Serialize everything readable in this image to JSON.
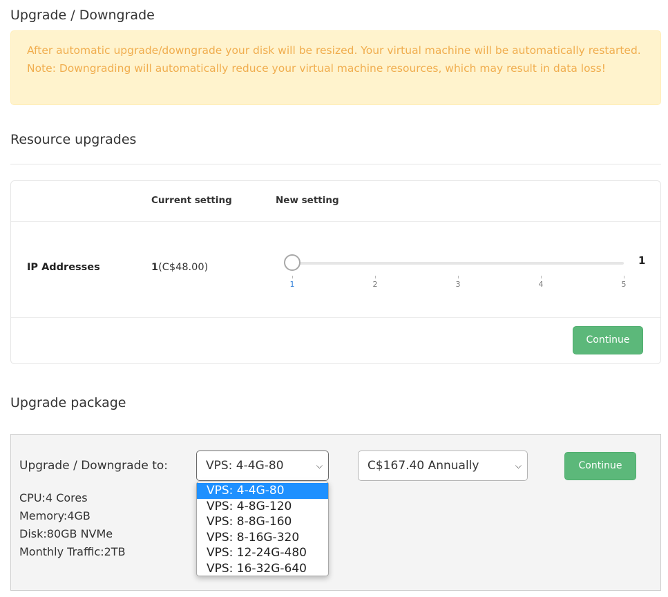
{
  "titles": {
    "upgrade_downgrade": "Upgrade / Downgrade",
    "resource_upgrades": "Resource upgrades",
    "upgrade_package": "Upgrade package"
  },
  "alert": {
    "text": "After automatic upgrade/downgrade your disk will be resized. Your virtual machine will be automatically restarted. Note: Downgrading will automatically reduce your virtual machine resources, which may result in data loss!"
  },
  "resource_table": {
    "col_current": "Current setting",
    "col_new": "New setting",
    "row_label": "IP Addresses",
    "current_value": "1",
    "current_price": "(C$48.00)",
    "slider_value": "1",
    "slider_ticks": [
      "1",
      "2",
      "3",
      "4",
      "5"
    ],
    "slider_level": 1,
    "continue_label": "Continue"
  },
  "package": {
    "label": "Upgrade / Downgrade to:",
    "selected_package": "VPS: 4-4G-80",
    "billing_cycle": "C$167.40 Annually",
    "continue_label": "Continue",
    "specs": [
      "CPU:4 Cores",
      "Memory:4GB",
      "Disk:80GB NVMe",
      "Monthly Traffic:2TB"
    ],
    "options": [
      "VPS: 4-4G-80",
      "VPS: 4-8G-120",
      "VPS: 8-8G-160",
      "VPS: 8-16G-320",
      "VPS: 12-24G-480",
      "VPS: 16-32G-640"
    ],
    "selected_index": 0
  },
  "colors": {
    "alert_bg": "#fff3cd",
    "alert_text": "#f0ad4e",
    "button_green": "#5cb87a",
    "dropdown_highlight": "#1e90ff"
  }
}
